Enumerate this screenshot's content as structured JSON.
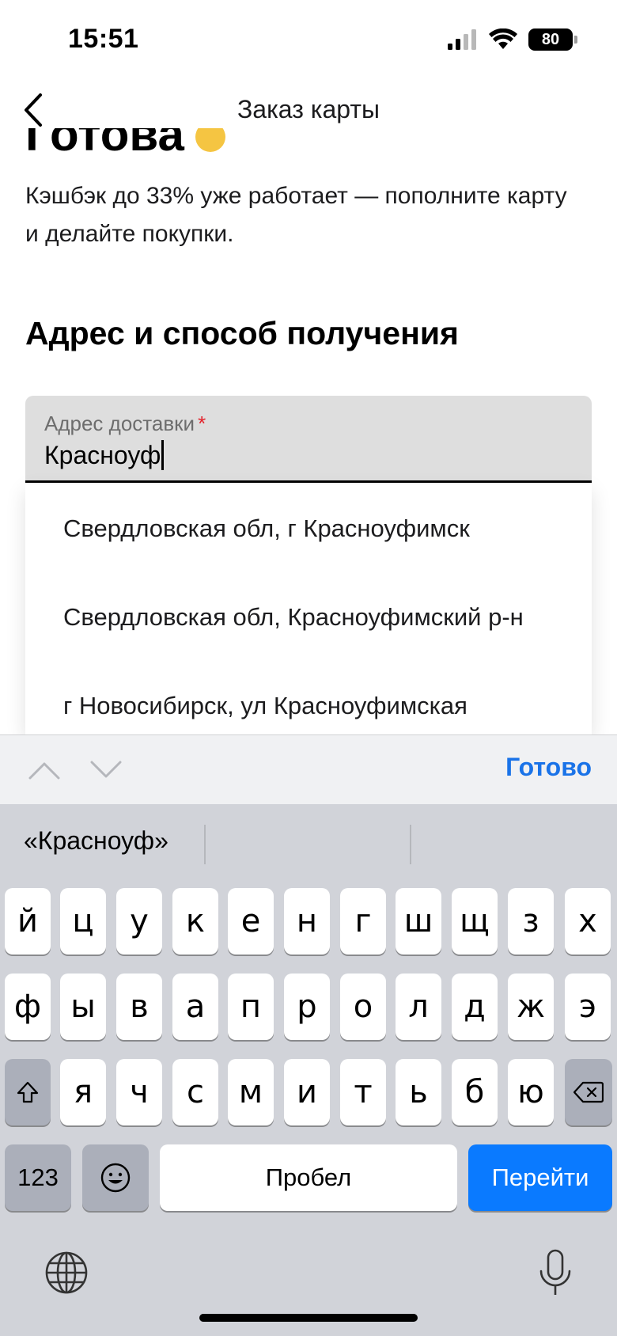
{
  "status": {
    "time": "15:51",
    "battery": "80"
  },
  "nav": {
    "title": "Заказ карты"
  },
  "content": {
    "heading_partial": "Готова",
    "subtitle": "Кэшбэк до 33% уже работает — пополните карту и делайте покупки.",
    "section_title": "Адрес и способ получения"
  },
  "address_field": {
    "label": "Адрес доставки",
    "required_mark": "*",
    "value": "Красноуф"
  },
  "suggestions": [
    {
      "label": "Свердловская обл, г Красноуфимск"
    },
    {
      "label": "Свердловская обл, Красноуфимский р-н"
    },
    {
      "label": "г Новосибирск, ул Красноуфимская"
    }
  ],
  "keyboard_toolbar": {
    "done_label": "Готово",
    "icons": [
      "chevron-up-icon",
      "chevron-down-icon"
    ]
  },
  "keyboard": {
    "prediction": "«Красноуф»",
    "row1": [
      "й",
      "ц",
      "у",
      "к",
      "е",
      "н",
      "г",
      "ш",
      "щ",
      "з",
      "х"
    ],
    "row2": [
      "ф",
      "ы",
      "в",
      "а",
      "п",
      "р",
      "о",
      "л",
      "д",
      "ж",
      "э"
    ],
    "row3": [
      "я",
      "ч",
      "с",
      "м",
      "и",
      "т",
      "ь",
      "б",
      "ю"
    ],
    "numbers_label": "123",
    "space_label": "Пробел",
    "go_label": "Перейти",
    "accent_color": "#0a7aff"
  }
}
